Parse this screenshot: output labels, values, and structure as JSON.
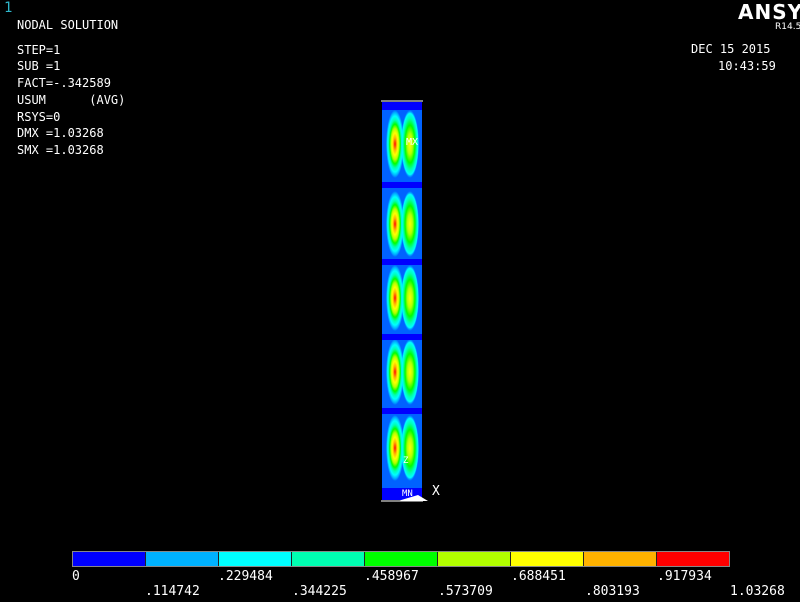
{
  "window_number": "1",
  "info": {
    "title": "NODAL SOLUTION",
    "lines": [
      "STEP=1",
      "SUB =1",
      "FACT=-.342589",
      "USUM      (AVG)",
      "RSYS=0",
      "DMX =1.03268",
      "SMX =1.03268"
    ]
  },
  "brand": {
    "name": "ANSYS",
    "version": "R14.5"
  },
  "datetime": {
    "date": "DEC 15 2015",
    "time": "10:43:59"
  },
  "model_labels": {
    "mx": "MX",
    "mn": "MN",
    "axis_x": "X",
    "axis_z": "Z"
  },
  "legend": {
    "colors": [
      "#0000ff",
      "#00b2ff",
      "#00ffff",
      "#00ffb2",
      "#00ff00",
      "#b2ff00",
      "#ffff00",
      "#ffb200",
      "#ff0000"
    ],
    "upper_labels": [
      "0",
      ".229484",
      ".458967",
      ".688451",
      ".917934"
    ],
    "lower_labels": [
      ".114742",
      ".344225",
      ".573709",
      ".803193",
      "1.03268"
    ]
  }
}
